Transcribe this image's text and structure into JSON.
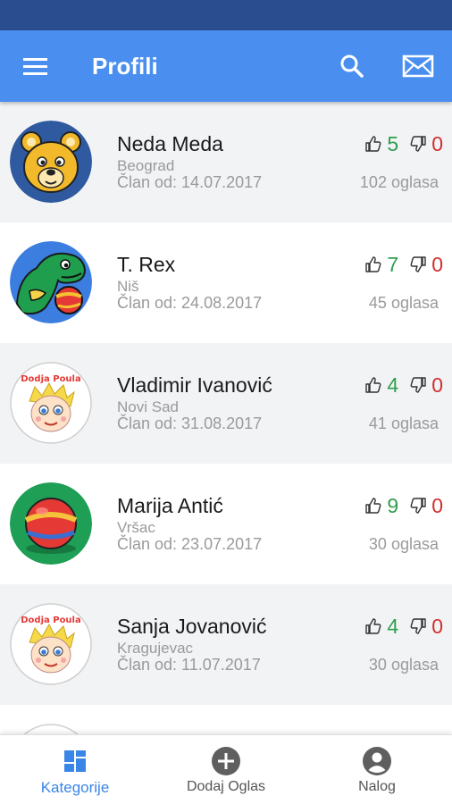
{
  "appbar": {
    "title": "Profili",
    "menu_icon": "hamburger-menu-icon",
    "search_icon": "search-icon",
    "mail_icon": "mail-icon"
  },
  "colors": {
    "primary": "#4a8fef",
    "status_bar": "#2a4d8f",
    "likes": "#2e9e4e",
    "dislikes": "#d32f2f",
    "active_nav": "#3a86e8"
  },
  "profiles": [
    {
      "name": "Neda Meda",
      "city": "Beograd",
      "member_since": "Član od: 14.07.2017",
      "likes": "5",
      "dislikes": "0",
      "ads": "102 oglasa",
      "avatar": "bear-avatar"
    },
    {
      "name": "T. Rex",
      "city": "Niš",
      "member_since": "Član od: 24.08.2017",
      "likes": "7",
      "dislikes": "0",
      "ads": "45 oglasa",
      "avatar": "dinosaur-avatar"
    },
    {
      "name": "Vladimir Ivanović",
      "city": "Novi Sad",
      "member_since": "Član od: 31.08.2017",
      "likes": "4",
      "dislikes": "0",
      "ads": "41 oglasa",
      "avatar": "dodja-poula-avatar"
    },
    {
      "name": "Marija Antić",
      "city": "Vršac",
      "member_since": "Član od: 23.07.2017",
      "likes": "9",
      "dislikes": "0",
      "ads": "30 oglasa",
      "avatar": "ball-avatar"
    },
    {
      "name": "Sanja Jovanović",
      "city": "Kragujevac",
      "member_since": "Član od: 11.07.2017",
      "likes": "4",
      "dislikes": "0",
      "ads": "30 oglasa",
      "avatar": "dodja-poula-avatar"
    }
  ],
  "avatar_logo_text": "Dodja Poula",
  "bottom_nav": [
    {
      "label": "Kategorije",
      "icon": "grid-icon",
      "active": true
    },
    {
      "label": "Dodaj Oglas",
      "icon": "add-circle-icon",
      "active": false
    },
    {
      "label": "Nalog",
      "icon": "account-icon",
      "active": false
    }
  ]
}
